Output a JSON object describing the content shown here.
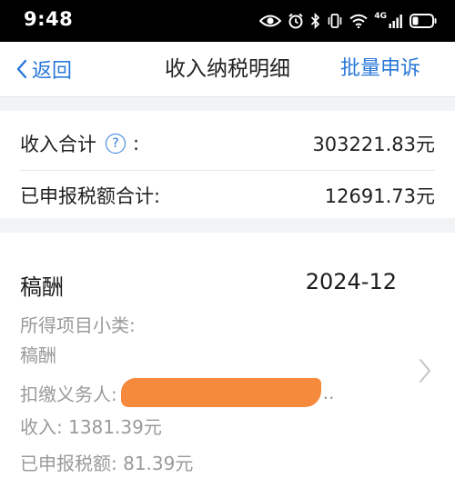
{
  "status_bar": {
    "time": "9:48",
    "network": "4G"
  },
  "nav": {
    "back_label": "返回",
    "title": "收入纳税明细",
    "action_label": "批量申诉"
  },
  "summary": {
    "income_total_label": "收入合计",
    "income_total_colon": ":",
    "income_total_value": "303221.83元",
    "declared_tax_total_label": "已申报税额合计:",
    "declared_tax_total_value": "12691.73元"
  },
  "record": {
    "type": "稿酬",
    "period": "2024-12",
    "subcategory_label": "所得项目小类:",
    "subcategory_value": "稿酬",
    "payer_label": "扣缴义务人:",
    "payer_suffix": "..",
    "income_label": "收入:",
    "income_value": "1381.39元",
    "declared_tax_label": "已申报税额:",
    "declared_tax_value": "81.39元"
  },
  "colors": {
    "accent": "#2a78d8",
    "redaction": "#f5893c",
    "background": "#f2f3f5",
    "muted_text": "#9a9a9a"
  },
  "icons": [
    "eye-icon",
    "alarm-icon",
    "bluetooth-icon",
    "vibrate-icon",
    "wifi-icon",
    "signal-icon",
    "battery-icon",
    "back-chevron-icon",
    "help-icon",
    "chevron-right-icon"
  ]
}
